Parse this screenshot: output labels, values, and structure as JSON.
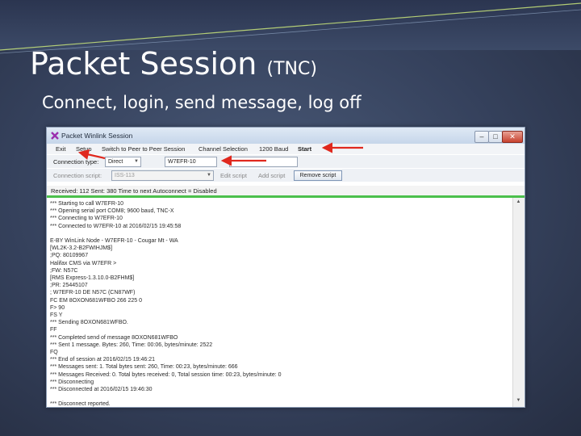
{
  "slide": {
    "title": "Packet Session",
    "title_suffix": "(TNC)",
    "subtitle": "Connect, login, send message, log off"
  },
  "window": {
    "title": "Packet Winlink Session",
    "min_glyph": "–",
    "max_glyph": "□",
    "close_glyph": "✕"
  },
  "menu": {
    "items": [
      "Exit",
      "Setup",
      "Switch to Peer to Peer Session",
      "Channel Selection",
      "1200 Baud",
      "Start"
    ]
  },
  "toolbar": {
    "connection_type_label": "Connection type:",
    "connection_type_value": "Direct",
    "callsign_value": "W7EFR-10",
    "connection_script_label": "Connection script:",
    "connection_script_value": "ISS-113",
    "edit_script": "Edit script",
    "add_script": "Add script",
    "remove_script": "Remove script"
  },
  "status": {
    "text": "Received: 112   Sent: 380   Time to next Autoconnect = Disabled"
  },
  "log": {
    "lines": [
      "*** Starting to call W7EFR-10",
      "*** Opening serial port COM8; 9600 baud, TNC-X",
      "*** Connecting to W7EFR-10",
      "*** Connected to W7EFR-10 at 2016/02/15 19:45:58",
      "",
      "E-BY WinLink Node - W7EFR-10 - Cougar Mt - WA",
      "[WL2K-3.2-B2FWIHJM$]",
      ";PQ: 80109967",
      "Halifax CMS via W7EFR >",
      " ;FW: N57C",
      " [RMS Express-1.3.10.0-B2FHM$]",
      " ;PR: 25445107",
      " ; W7EFR-10 DE N57C (CN87WF)",
      " FC EM 8OXON681WFBO 266 225 0",
      " F> 90",
      "FS Y",
      "*** Sending 8OXON681WFBO.",
      "FF",
      "*** Completed send of message 8OXON681WFBO",
      "*** Sent 1 message.  Bytes: 260,  Time: 00:06,  bytes/minute: 2522",
      "FQ",
      "*** End of session at 2016/02/15 19:46:21",
      "*** Messages sent: 1.  Total bytes sent: 260,  Time: 00:23,  bytes/minute: 666",
      "*** Messages Received: 0.  Total bytes received: 0,  Total session time: 00:23,  bytes/minute: 0",
      "*** Disconnecting",
      "*** Disconnected at 2016/02/15 19:46:30",
      "",
      "*** Disconnect reported."
    ]
  },
  "colors": {
    "annotation_arrow": "#e0281e",
    "status_bar_line": "#4cc04c",
    "slide_accent": "#c9e57a"
  }
}
